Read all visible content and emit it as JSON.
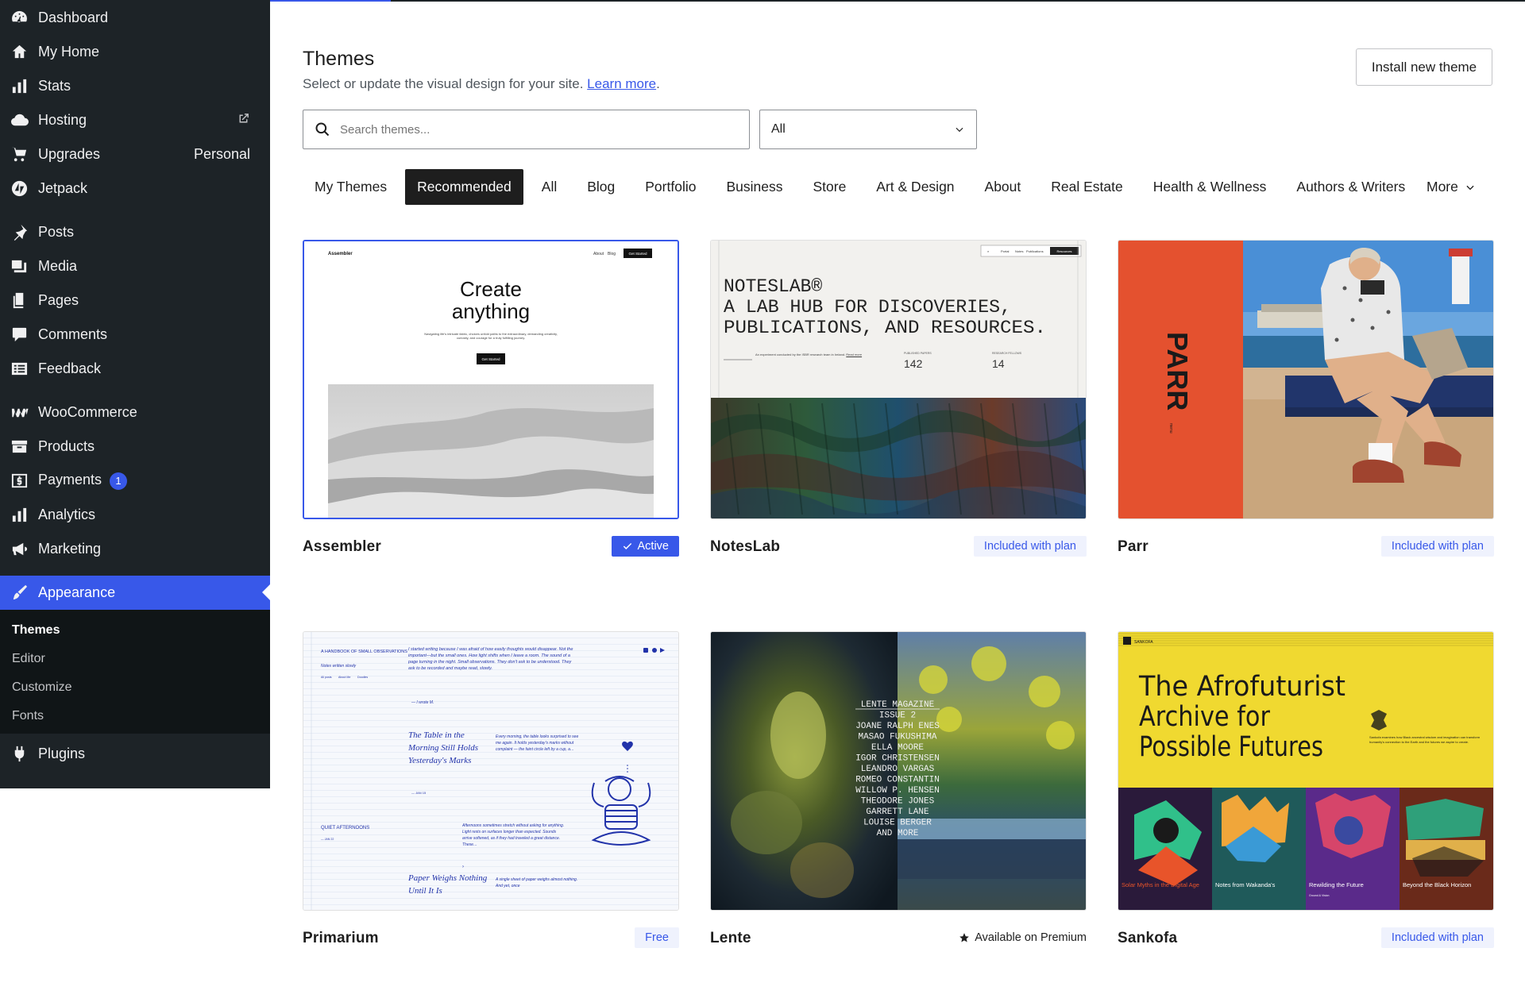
{
  "sidebar": {
    "items": [
      {
        "label": "Dashboard"
      },
      {
        "label": "My Home"
      },
      {
        "label": "Stats"
      },
      {
        "label": "Hosting"
      },
      {
        "label": "Upgrades",
        "right": "Personal"
      },
      {
        "label": "Jetpack"
      },
      {
        "label": "Posts"
      },
      {
        "label": "Media"
      },
      {
        "label": "Pages"
      },
      {
        "label": "Comments"
      },
      {
        "label": "Feedback"
      },
      {
        "label": "WooCommerce"
      },
      {
        "label": "Products"
      },
      {
        "label": "Payments",
        "badge": "1"
      },
      {
        "label": "Analytics"
      },
      {
        "label": "Marketing"
      },
      {
        "label": "Appearance"
      },
      {
        "label": "Plugins"
      }
    ],
    "submenu": [
      "Themes",
      "Editor",
      "Customize",
      "Fonts"
    ]
  },
  "header": {
    "title": "Themes",
    "description": "Select or update the visual design for your site.",
    "learn_more": "Learn more",
    "install_button": "Install new theme"
  },
  "search": {
    "placeholder": "Search themes...",
    "filter_value": "All"
  },
  "tabs": [
    "My Themes",
    "Recommended",
    "All",
    "Blog",
    "Portfolio",
    "Business",
    "Store",
    "Art & Design",
    "About",
    "Real Estate",
    "Health & Wellness",
    "Authors & Writers"
  ],
  "active_tab": "Recommended",
  "more_tab": "More",
  "themes": [
    {
      "name": "Assembler",
      "badge": "Active",
      "preview": {
        "brand": "Assembler",
        "nav": [
          "About",
          "Blog"
        ],
        "cta": "Get Started",
        "headline_1": "Create",
        "headline_2": "anything",
        "body": "Navigating life's intricate fabric, choices unfold paths to the extraordinary, demanding creativity, curiosity, and courage for a truly fulfilling journey.",
        "button": "Get Started"
      }
    },
    {
      "name": "NotesLab",
      "badge": "Included with plan",
      "preview": {
        "nav": [
          "Portal",
          "Notes",
          "Publications"
        ],
        "nav_active": "Resources",
        "title_1": "NOTESLAB®",
        "title_2": "A LAB HUB FOR DISCOVERIES,",
        "title_3": "PUBLICATIONS, AND RESOURCES.",
        "note": "An experiment conducted by the ISBR research team in Ireland.",
        "note_link": "Read more",
        "stat1_label": "PUBLISHED PAPERS",
        "stat1": "142",
        "stat2_label": "RESEARCH FELLOWS",
        "stat2": "14"
      }
    },
    {
      "name": "Parr",
      "badge": "Included with plan",
      "preview": {
        "logo": "PARR",
        "menu": "menu"
      }
    },
    {
      "name": "Primarium",
      "badge": "Free",
      "preview": {
        "section1": "A HANDBOOK OF SMALL OBSERVATIONS",
        "section1_sub": "Notes written slowly",
        "nav": [
          "All posts",
          "About Me",
          "Doodles"
        ],
        "intro": "I started writing because I was afraid of how easily thoughts would disappear. Not the important—but the small ones. How light shifts when I leave a room. The sound of a page turning in the night. Small observations. They don't ask to be understood. They ask to be recorded and maybe read, slowly.",
        "signature": "— I wrote M.",
        "post1_title": "The Table in the Morning Still Holds Yesterday's Marks",
        "post1_excerpt": "Every morning, the table looks surprised to see me again. It holds yesterday's marks without complaint — the faint circle left by a cup, a…",
        "post1_date": "— JAN 15",
        "section2": "QUIET AFTERNOONS",
        "section2_date": "— JAN 22",
        "post2_excerpt": "Afternoons sometimes stretch without asking for anything. Light rests on surfaces longer than expected. Sounds arrive softened, as if they had traveled a great distance. These…",
        "post3_title": "Paper Weighs Nothing Until It Is",
        "post3_excerpt": "A single sheet of paper weighs almost nothing. And yet, once"
      }
    },
    {
      "name": "Lente",
      "badge": "Available on Premium",
      "preview": {
        "lines": [
          "LENTE MAGAZINE",
          "ISSUE 2",
          "JOANE RALPH ENES",
          "MASAO FUKUSHIMA",
          "ELLA MOORE",
          "IGOR CHRISTENSEN",
          "LEANDRO VARGAS",
          "ROMEO CONSTANTIN",
          "WILLOW P. HENSEN",
          "THEODORE JONES",
          "GARRETT LANE",
          "LOUISE BERGER",
          "AND MORE"
        ]
      }
    },
    {
      "name": "Sankofa",
      "badge": "Included with plan",
      "preview": {
        "brand": "SANKOFA",
        "headline_1": "The Afrofuturist",
        "headline_2": "Archive for",
        "headline_3": "Possible Futures",
        "blurb": "Sankofa examines how Black ancestral wisdom and imagination can transform humanity's connection to the Earth and the futures we aspire to create.",
        "tiles": [
          "Solar Myths in the Digital Age",
          "Notes from Wakanda's",
          "Rewilding the Future",
          "Beyond the Black Horizon"
        ],
        "tile_meta": "Ground & Vision"
      }
    }
  ],
  "colors": {
    "accent": "#3858e9",
    "sidebar_bg": "#1d2327",
    "badge_bg": "#eff2fd",
    "parr_orange": "#e4512f",
    "sankofa_yellow": "#f0d930"
  }
}
